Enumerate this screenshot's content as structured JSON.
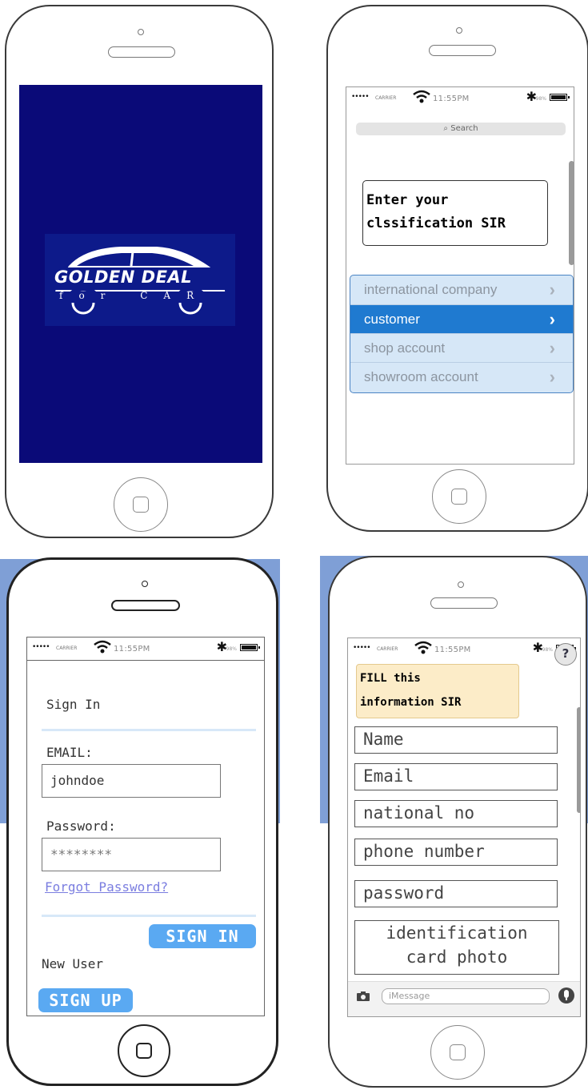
{
  "splash": {
    "logo_title": "GOLDEN DEAL",
    "logo_subtitle": "for CAR",
    "background_color": "#0a0a78"
  },
  "classification": {
    "search_placeholder": "Search",
    "prompt": "Enter your clssification SIR",
    "options": [
      {
        "label": "international company",
        "selected": false
      },
      {
        "label": "customer",
        "selected": true
      },
      {
        "label": "shop account",
        "selected": false
      },
      {
        "label": "showroom account",
        "selected": false
      }
    ]
  },
  "signin": {
    "title": "Sign In",
    "email_label": "EMAIL:",
    "email_value": "johndoe",
    "password_label": "Password:",
    "password_value": "********",
    "forgot_link": "Forgot Password?",
    "signin_button": "SIGN IN",
    "new_user_label": "New User",
    "signup_button": "SIGN UP"
  },
  "register": {
    "note_line1": "FILL this",
    "note_line2": "information SIR",
    "help_label": "?",
    "fields": [
      "Name",
      "Email",
      "national no",
      "phone number",
      "password"
    ],
    "photo_field_line1": "identification",
    "photo_field_line2": "card photo",
    "message_placeholder": "iMessage"
  },
  "status_bar": {
    "signal": "•••••",
    "carrier": "CARRIER",
    "time": "11:55PM",
    "battery_pct": "98%"
  },
  "colors": {
    "accent_blue": "#1f7ad0",
    "button_blue": "#5aa9f2",
    "note_yellow": "#fcecc8",
    "phone_bg_frame": "#7f9fd6"
  }
}
